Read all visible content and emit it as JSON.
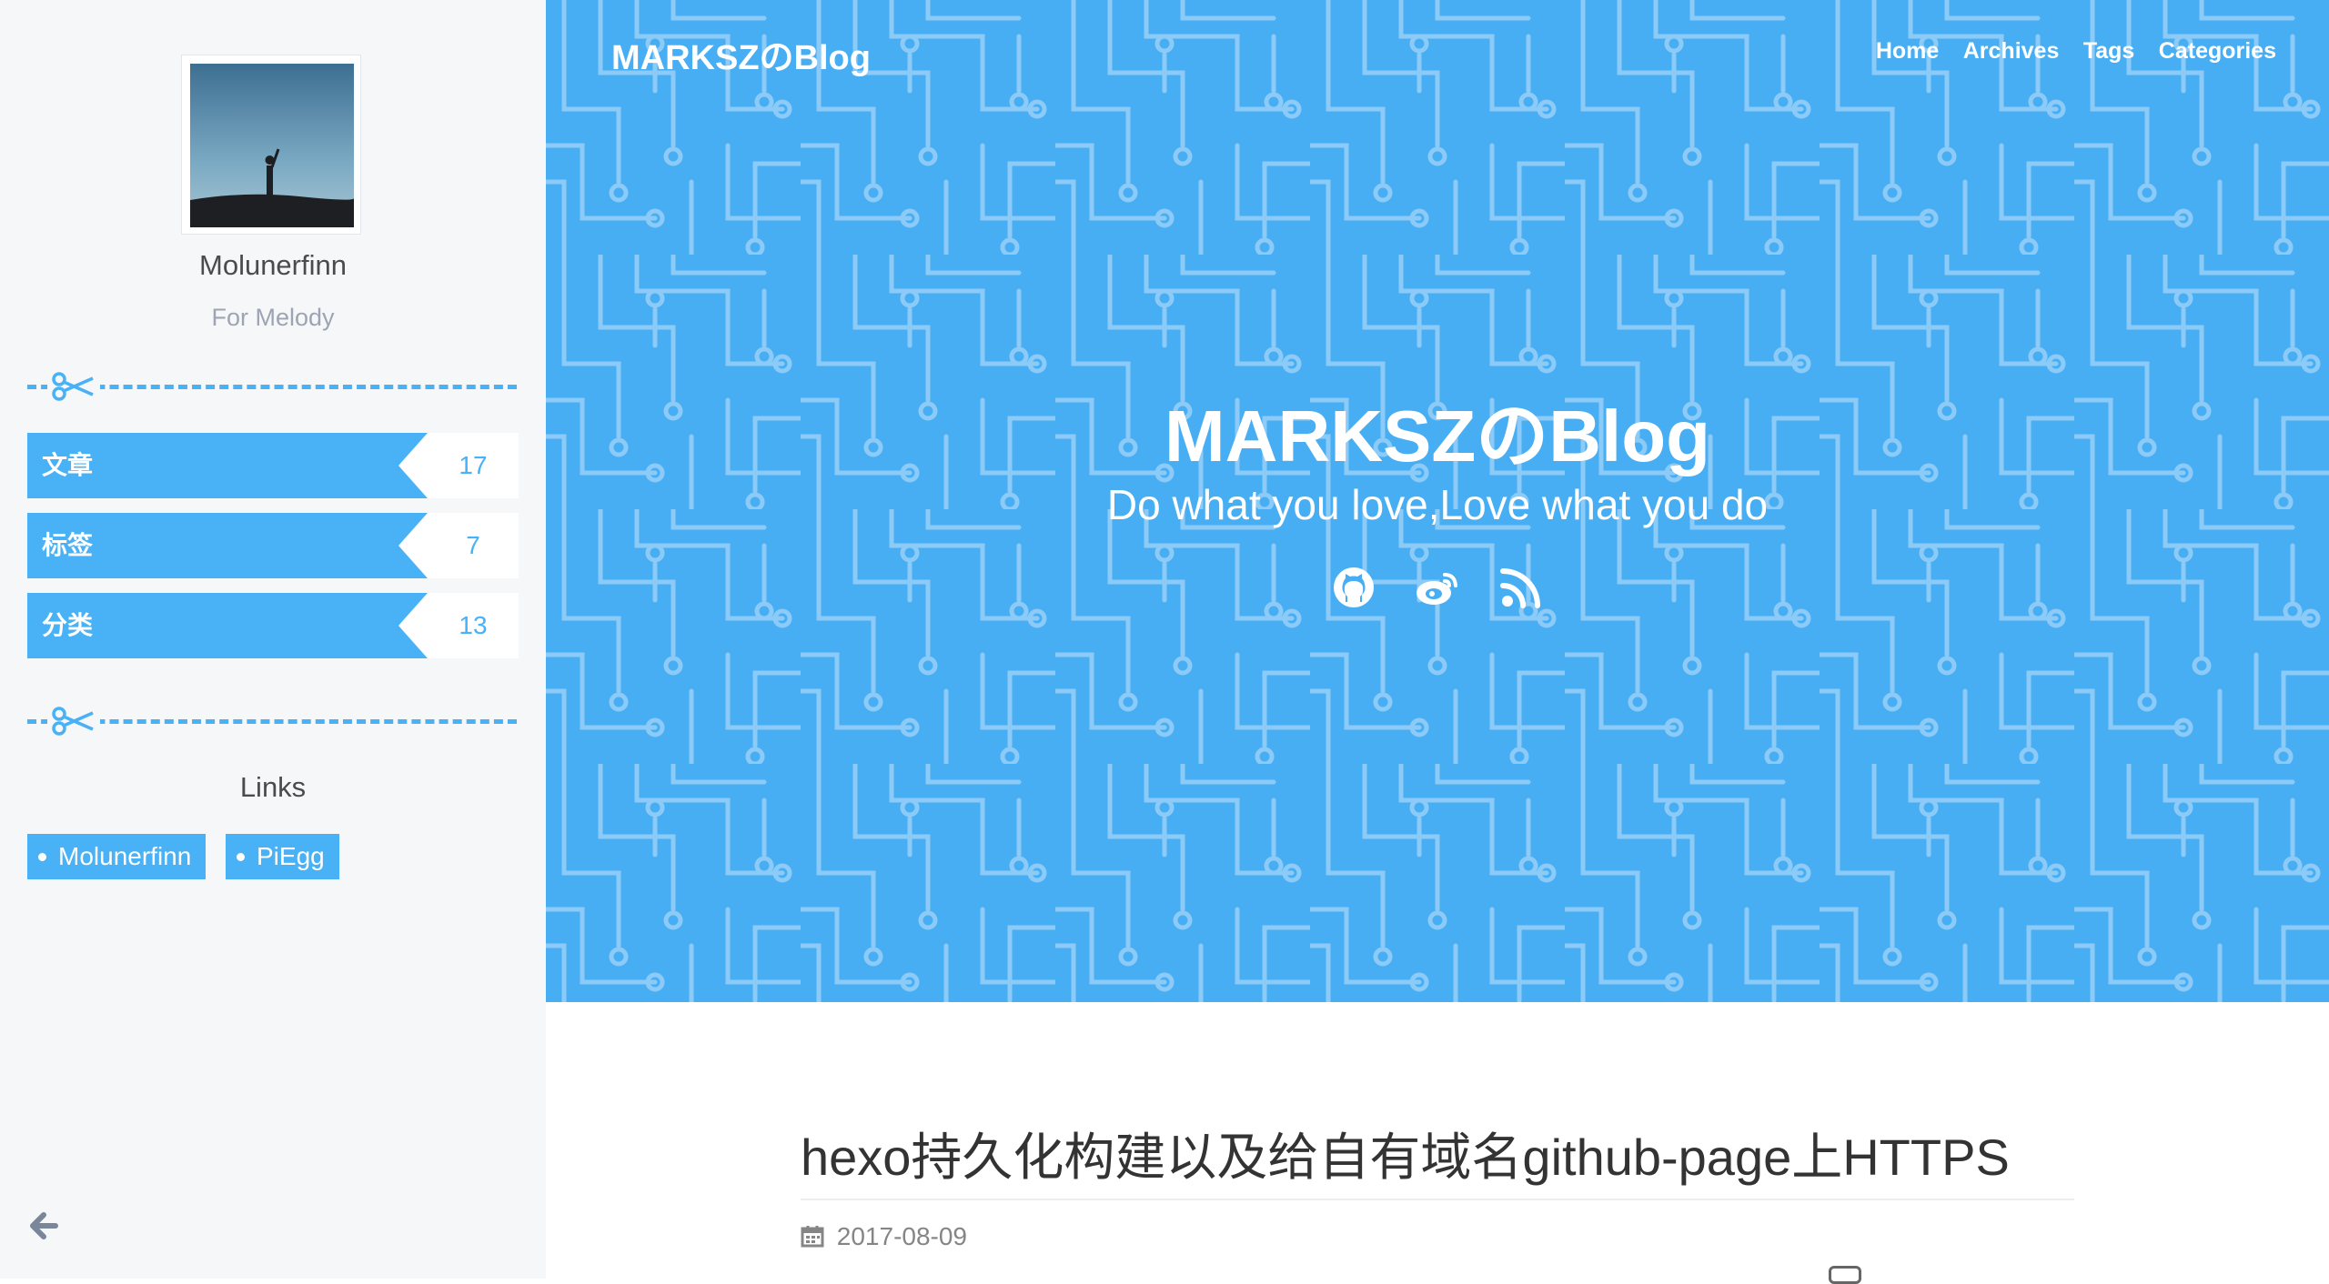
{
  "sidebar": {
    "author_name": "Molunerfinn",
    "author_description": "For Melody",
    "stats": [
      {
        "label": "文章",
        "count": "17"
      },
      {
        "label": "标签",
        "count": "7"
      },
      {
        "label": "分类",
        "count": "13"
      }
    ],
    "links_title": "Links",
    "links": [
      {
        "label": "Molunerfinn"
      },
      {
        "label": "PiEgg"
      }
    ],
    "collapse_icon": "arrow-left-icon"
  },
  "header": {
    "brand": "MARKSZのBlog",
    "nav": [
      "Home",
      "Archives",
      "Tags",
      "Categories"
    ],
    "title": "MARKSZのBlog",
    "subtitle": "Do what you love,Love what you do",
    "social_icons": [
      "github-icon",
      "weibo-icon",
      "rss-icon"
    ]
  },
  "post": {
    "title": "hexo持久化构建以及给自有域名github-page上HTTPS",
    "date": "2017-08-09",
    "date_icon": "calendar-icon"
  },
  "colors": {
    "accent": "#49b1f5",
    "header_bg": "#48aef3",
    "sidebar_bg": "#f6f7f9"
  }
}
